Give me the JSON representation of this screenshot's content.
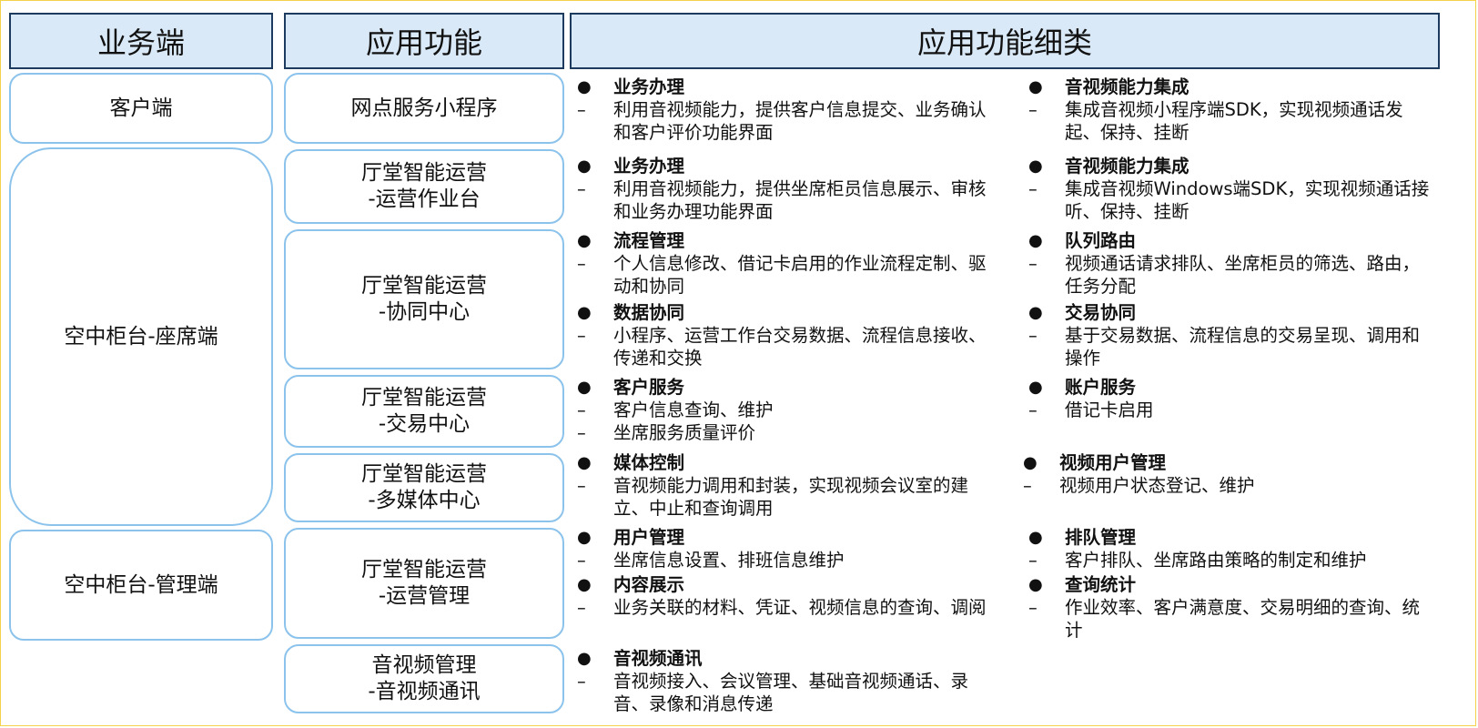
{
  "headers": {
    "business_end": "业务端",
    "app_function": "应用功能",
    "app_function_detail": "应用功能细类"
  },
  "business_ends": [
    "客户端",
    "空中柜台-座席端",
    "空中柜台-管理端"
  ],
  "functions": [
    "网点服务小程序",
    "厅堂智能运营\n-运营作业台",
    "厅堂智能运营\n-协同中心",
    "厅堂智能运营\n-交易中心",
    "厅堂智能运营\n-多媒体中心",
    "厅堂智能运营\n-运营管理",
    "音视频管理\n-音视频通讯"
  ],
  "bullet_symbol": "●",
  "dash_symbol": "–",
  "details": [
    {
      "title": "业务办理",
      "lines": [
        "利用音视频能力，提供客户信息提交、业务确认和客户评价功能界面"
      ]
    },
    {
      "title": "音视频能力集成",
      "lines": [
        "集成音视频小程序端SDK，实现视频通话发起、保持、挂断"
      ]
    },
    {
      "title": "业务办理",
      "lines": [
        "利用音视频能力，提供坐席柜员信息展示、审核和业务办理功能界面"
      ]
    },
    {
      "title": "音视频能力集成",
      "lines": [
        "集成音视频Windows端SDK，实现视频通话接听、保持、挂断"
      ]
    },
    {
      "title": "流程管理",
      "lines": [
        "个人信息修改、借记卡启用的作业流程定制、驱动和协同"
      ]
    },
    {
      "title": "队列路由",
      "lines": [
        "视频通话请求排队、坐席柜员的筛选、路由，任务分配"
      ]
    },
    {
      "title": "数据协同",
      "lines": [
        "小程序、运营工作台交易数据、流程信息接收、传递和交换"
      ]
    },
    {
      "title": "交易协同",
      "lines": [
        "基于交易数据、流程信息的交易呈现、调用和操作"
      ]
    },
    {
      "title": "客户服务",
      "lines": [
        "客户信息查询、维护",
        "坐席服务质量评价"
      ]
    },
    {
      "title": "账户服务",
      "lines": [
        "借记卡启用"
      ]
    },
    {
      "title": "媒体控制",
      "lines": [
        "音视频能力调用和封装，实现视频会议室的建立、中止和查询调用"
      ]
    },
    {
      "title": "视频用户管理",
      "lines": [
        "视频用户状态登记、维护"
      ]
    },
    {
      "title": "用户管理",
      "lines": [
        "坐席信息设置、排班信息维护"
      ]
    },
    {
      "title": "排队管理",
      "lines": [
        "客户排队、坐席路由策略的制定和维护"
      ]
    },
    {
      "title": "内容展示",
      "lines": [
        "业务关联的材料、凭证、视频信息的查询、调阅"
      ]
    },
    {
      "title": "查询统计",
      "lines": [
        "作业效率、客户满意度、交易明细的查询、统计"
      ]
    },
    {
      "title": "音视频通讯",
      "lines": [
        "音视频接入、会议管理、基础音视频通话、录音、录像和消息传递"
      ]
    }
  ]
}
